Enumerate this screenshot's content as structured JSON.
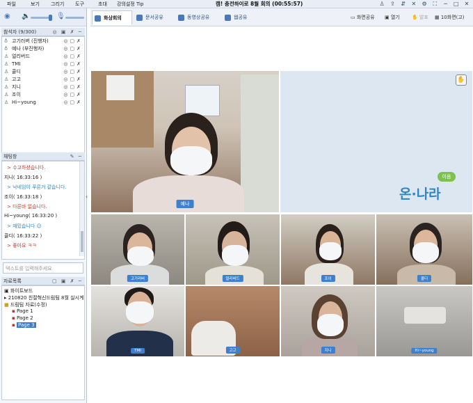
{
  "menu": {
    "items": [
      "파일",
      "보기",
      "그리기",
      "도구",
      "초대",
      "강의설정 Tip"
    ],
    "meeting_title": "캠! 충전하이로 8월 회의 (00:55:57)"
  },
  "participants": {
    "header": "참석자 (9/300)",
    "list": [
      {
        "name": "고기러버 (진행자)",
        "role": "host"
      },
      {
        "name": "예나 (부진행자)",
        "role": "cohost"
      },
      {
        "name": "얼리버드",
        "role": "member"
      },
      {
        "name": "TMI",
        "role": "member"
      },
      {
        "name": "콜디",
        "role": "member"
      },
      {
        "name": "고고",
        "role": "member"
      },
      {
        "name": "지니",
        "role": "member"
      },
      {
        "name": "조이",
        "role": "member"
      },
      {
        "name": "Hi~young",
        "role": "member"
      }
    ]
  },
  "chat": {
    "header": "채팅창",
    "lines": [
      {
        "type": "msg",
        "text": "> 수고하셨습니다.",
        "color": "#c0392b"
      },
      {
        "type": "name",
        "text": "지니( 16:33:16 )"
      },
      {
        "type": "msg",
        "text": "> 낙네임이 푸른거 같습니다.",
        "color": "#2e86c1"
      },
      {
        "type": "name",
        "text": "조이( 16:33:18 )"
      },
      {
        "type": "msg",
        "text": "> 다른바 없습니다.",
        "color": "#c0392b"
      },
      {
        "type": "name",
        "text": "Hi~young( 16:33:20 )"
      },
      {
        "type": "msg",
        "text": "> 재밌습니다 ☺",
        "color": "#2e86c1"
      },
      {
        "type": "name",
        "text": "콜디( 16:33:22 )"
      },
      {
        "type": "msg",
        "text": "> 좋아요 ㅋㅋ",
        "color": "#c0392b"
      }
    ],
    "input_placeholder": "텍스트를 입력해주세요"
  },
  "materials": {
    "header": "자료목록",
    "items": [
      {
        "label": "화이트보드",
        "level": 0
      },
      {
        "label": "210820 친절혁신드림팀 8월 실시계",
        "level": 0
      },
      {
        "label": "드림팀 자료(수정)",
        "level": 1
      },
      {
        "label": "Page 1",
        "level": 2
      },
      {
        "label": "Page 2",
        "level": 2
      },
      {
        "label": "Page 3",
        "level": 2,
        "selected": true
      }
    ]
  },
  "tabs": [
    {
      "label": "화상회의",
      "active": true
    },
    {
      "label": "문서공유",
      "active": false
    },
    {
      "label": "동영상공유",
      "active": false
    },
    {
      "label": "웹공유",
      "active": false
    }
  ],
  "toolbar": {
    "screen_share": "화면공유",
    "open": "열기",
    "raise_hand": "발표",
    "layout": "10화면(고)"
  },
  "brand": {
    "logo_text": "온·나라",
    "logo_badge": "이음"
  },
  "videos": {
    "main": {
      "name": "예나"
    },
    "grid": [
      {
        "name": "고기러버"
      },
      {
        "name": "얼리버드"
      },
      {
        "name": "조이"
      },
      {
        "name": "콜디"
      },
      {
        "name": "TMI"
      },
      {
        "name": "고고"
      },
      {
        "name": "지니"
      },
      {
        "name": "Hi~young"
      }
    ]
  },
  "colors": {
    "accent": "#3f7fcf",
    "chat_red": "#c0392b",
    "chat_blue": "#2e86c1"
  }
}
